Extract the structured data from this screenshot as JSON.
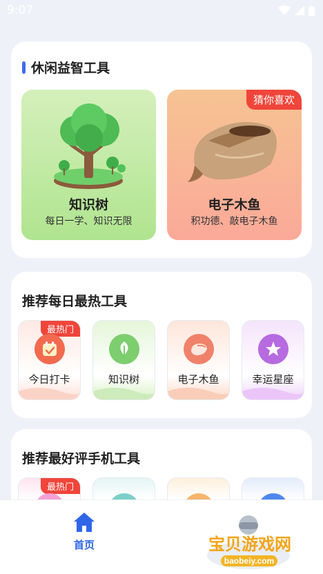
{
  "status_bar": {
    "time": "9:07"
  },
  "section_leisure": {
    "title": "休闲益智工具",
    "tiles": [
      {
        "name": "知识树",
        "subtitle": "每日一学、知识无限",
        "icon": "tree-illustration"
      },
      {
        "name": "电子木鱼",
        "subtitle": "积功德、敲电子木鱼",
        "badge": "猜你喜欢",
        "icon": "wooden-fish-illustration"
      }
    ]
  },
  "section_daily_hot": {
    "title": "推荐每日最热工具",
    "items": [
      {
        "label": "今日打卡",
        "badge": "最热门",
        "icon": "calendar-check-icon",
        "color": "#f26a4f"
      },
      {
        "label": "知识树",
        "icon": "leaf-icon",
        "color": "#7dce6e"
      },
      {
        "label": "电子木鱼",
        "icon": "wooden-fish-icon",
        "color": "#f0826b"
      },
      {
        "label": "幸运星座",
        "icon": "star-icon",
        "color": "#b66be0"
      }
    ]
  },
  "section_top_rated": {
    "title": "推荐最好评手机工具",
    "items": [
      {
        "badge": "最热门"
      },
      {},
      {},
      {}
    ]
  },
  "bottom_nav": {
    "home_label": "首页",
    "accent": "#2f66e8"
  },
  "watermark": {
    "title": "宝贝游戏网",
    "url": "baobeiy.com"
  }
}
